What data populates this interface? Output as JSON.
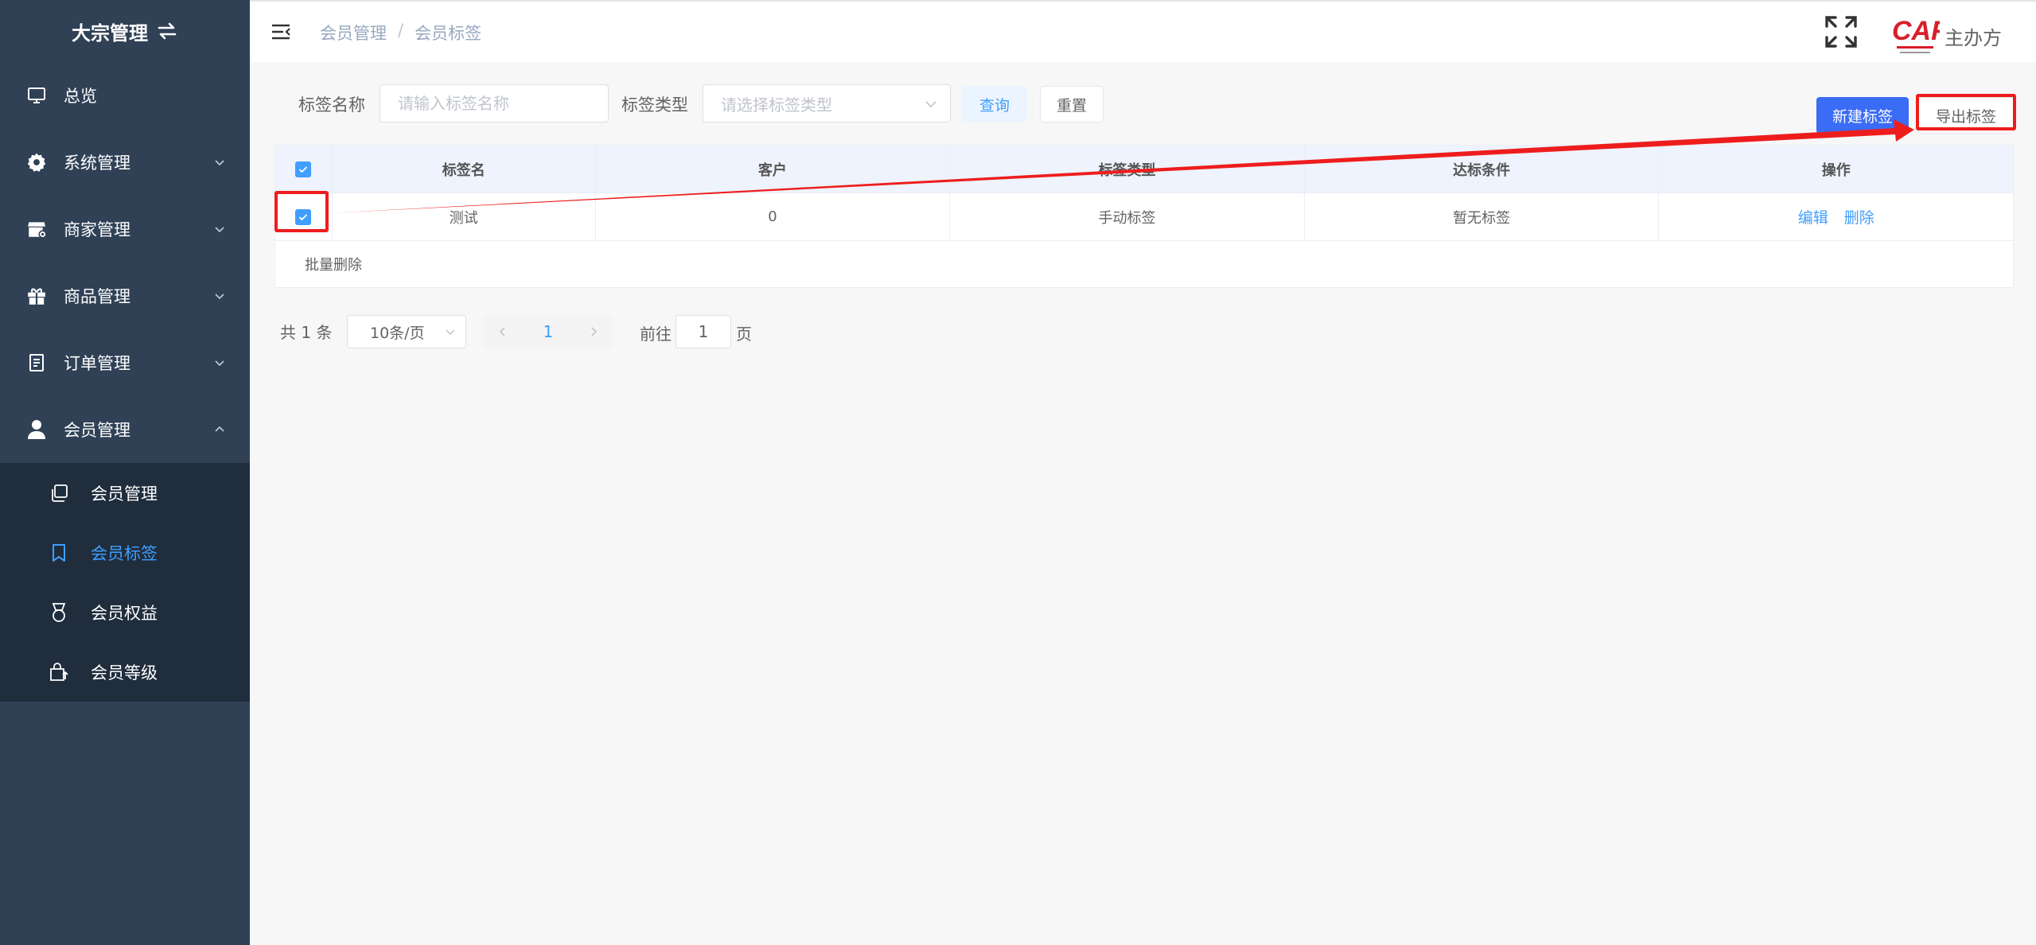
{
  "sidebar": {
    "title": "大宗管理",
    "items": [
      {
        "label": "总览",
        "icon": "monitor-icon"
      },
      {
        "label": "系统管理",
        "icon": "gear-icon"
      },
      {
        "label": "商家管理",
        "icon": "store-icon"
      },
      {
        "label": "商品管理",
        "icon": "gift-icon"
      },
      {
        "label": "订单管理",
        "icon": "document-icon"
      },
      {
        "label": "会员管理",
        "icon": "user-icon"
      }
    ],
    "submenu": [
      {
        "label": "会员管理",
        "icon": "copy-icon"
      },
      {
        "label": "会员标签",
        "icon": "bookmark-icon",
        "active": true
      },
      {
        "label": "会员权益",
        "icon": "medal-icon"
      },
      {
        "label": "会员等级",
        "icon": "bag-icon"
      }
    ]
  },
  "header": {
    "breadcrumb": [
      "会员管理",
      "会员标签"
    ],
    "breadcrumb_sep": "/",
    "logo_text": "CAF",
    "host_label": "主办方"
  },
  "filters": {
    "tag_name_label": "标签名称",
    "tag_name_placeholder": "请输入标签名称",
    "tag_type_label": "标签类型",
    "tag_type_placeholder": "请选择标签类型",
    "query_label": "查询",
    "reset_label": "重置"
  },
  "actions": {
    "new_tag_label": "新建标签",
    "export_tag_label": "导出标签"
  },
  "table": {
    "columns": [
      "标签名",
      "客户",
      "标签类型",
      "达标条件",
      "操作"
    ],
    "rows": [
      {
        "name": "测试",
        "customers": "0",
        "type": "手动标签",
        "condition": "暂无标签",
        "edit": "编辑",
        "delete": "删除"
      }
    ],
    "batch_delete_label": "批量删除"
  },
  "pagination": {
    "total_text": "共 1 条",
    "page_size": "10条/页",
    "current_page": "1",
    "goto_label": "前往",
    "goto_value": "1",
    "page_suffix": "页"
  },
  "colors": {
    "sidebar_bg": "#304156",
    "active": "#409eff",
    "primary": "#3a6cf6",
    "annotation": "#ee1d1d"
  }
}
